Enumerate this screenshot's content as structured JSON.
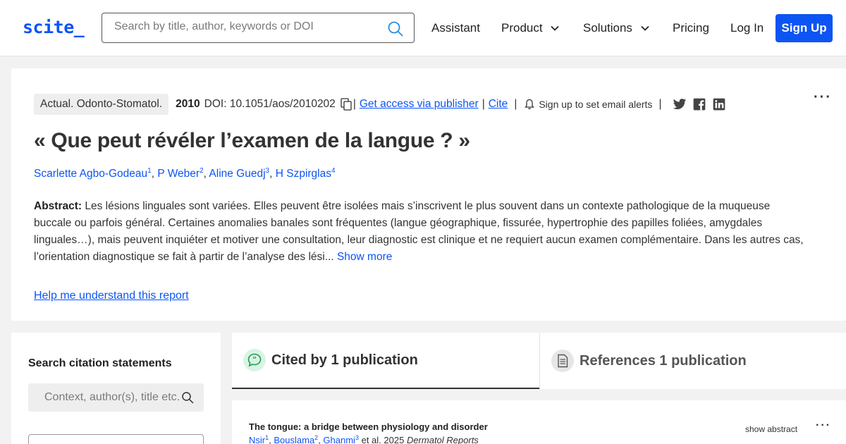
{
  "header": {
    "logo": "scite_",
    "search_placeholder": "Search by title, author, keywords or DOI",
    "nav": {
      "assistant": "Assistant",
      "product": "Product",
      "solutions": "Solutions",
      "pricing": "Pricing",
      "login": "Log In",
      "signup": "Sign Up"
    }
  },
  "paper": {
    "journal": "Actual. Odonto-Stomatol.",
    "year": "2010",
    "doi": "DOI: 10.1051/aos/2010202",
    "sep": "|",
    "get_access": "Get access via publisher",
    "cite": "Cite",
    "alerts": "Sign up to set email alerts",
    "more": "···",
    "title": "« Que peut révéler l’examen de la langue ? »",
    "authors": [
      {
        "name": "Scarlette Agbo-Godeau",
        "sup": "1"
      },
      {
        "name": "P Weber",
        "sup": "2"
      },
      {
        "name": "Aline Guedj",
        "sup": "3"
      },
      {
        "name": "H Szpirglas",
        "sup": "4"
      }
    ],
    "comma": ", ",
    "abstract_label": "Abstract:",
    "abstract_text": " Les lésions linguales sont variées. Elles peuvent être isolées mais s’inscrivent le plus souvent dans un contexte pathologique de la muqueuse buccale ou parfois général. Certaines anomalies banales sont fréquentes (langue géographique, fissurée, hypertrophie des papilles foliées, amygdales linguales…), mais peuvent inquiéter et motiver une consultation, leur diagnostic est clinique et ne requiert aucun examen complémentaire. Dans les autres cas, l’orientation diagnostique se fait à partir de l’analyse des lési...",
    "show_more": "Show more",
    "help_link": "Help me understand this report"
  },
  "sidebar": {
    "title": "Search citation statements",
    "context_placeholder": "Context, author(s), title etc."
  },
  "tabs": {
    "cited_by": "Cited by 1 publication",
    "references": "References 1 publication"
  },
  "results": [
    {
      "title": "The tongue: a bridge between physiology and disorder",
      "authors": [
        {
          "name": "Nsir",
          "sup": "1"
        },
        {
          "name": "Bouslama",
          "sup": "2"
        },
        {
          "name": "Ghanmi",
          "sup": "3"
        }
      ],
      "etal_year": "et al. 2025",
      "journal": "Dermatol Reports",
      "show_abstract": "show abstract",
      "more": "···"
    }
  ],
  "colors": {
    "brand_blue": "#0c54f4",
    "cited_icon_bg": "#daf3e3",
    "refs_icon_bg": "#e6e6e6"
  },
  "icons": [
    "search-icon",
    "copy-icon",
    "bell-icon",
    "twitter-icon",
    "facebook-icon",
    "linkedin-icon",
    "chevron-down-icon",
    "quote-bubble-icon",
    "document-icon",
    "more-options-icon"
  ]
}
